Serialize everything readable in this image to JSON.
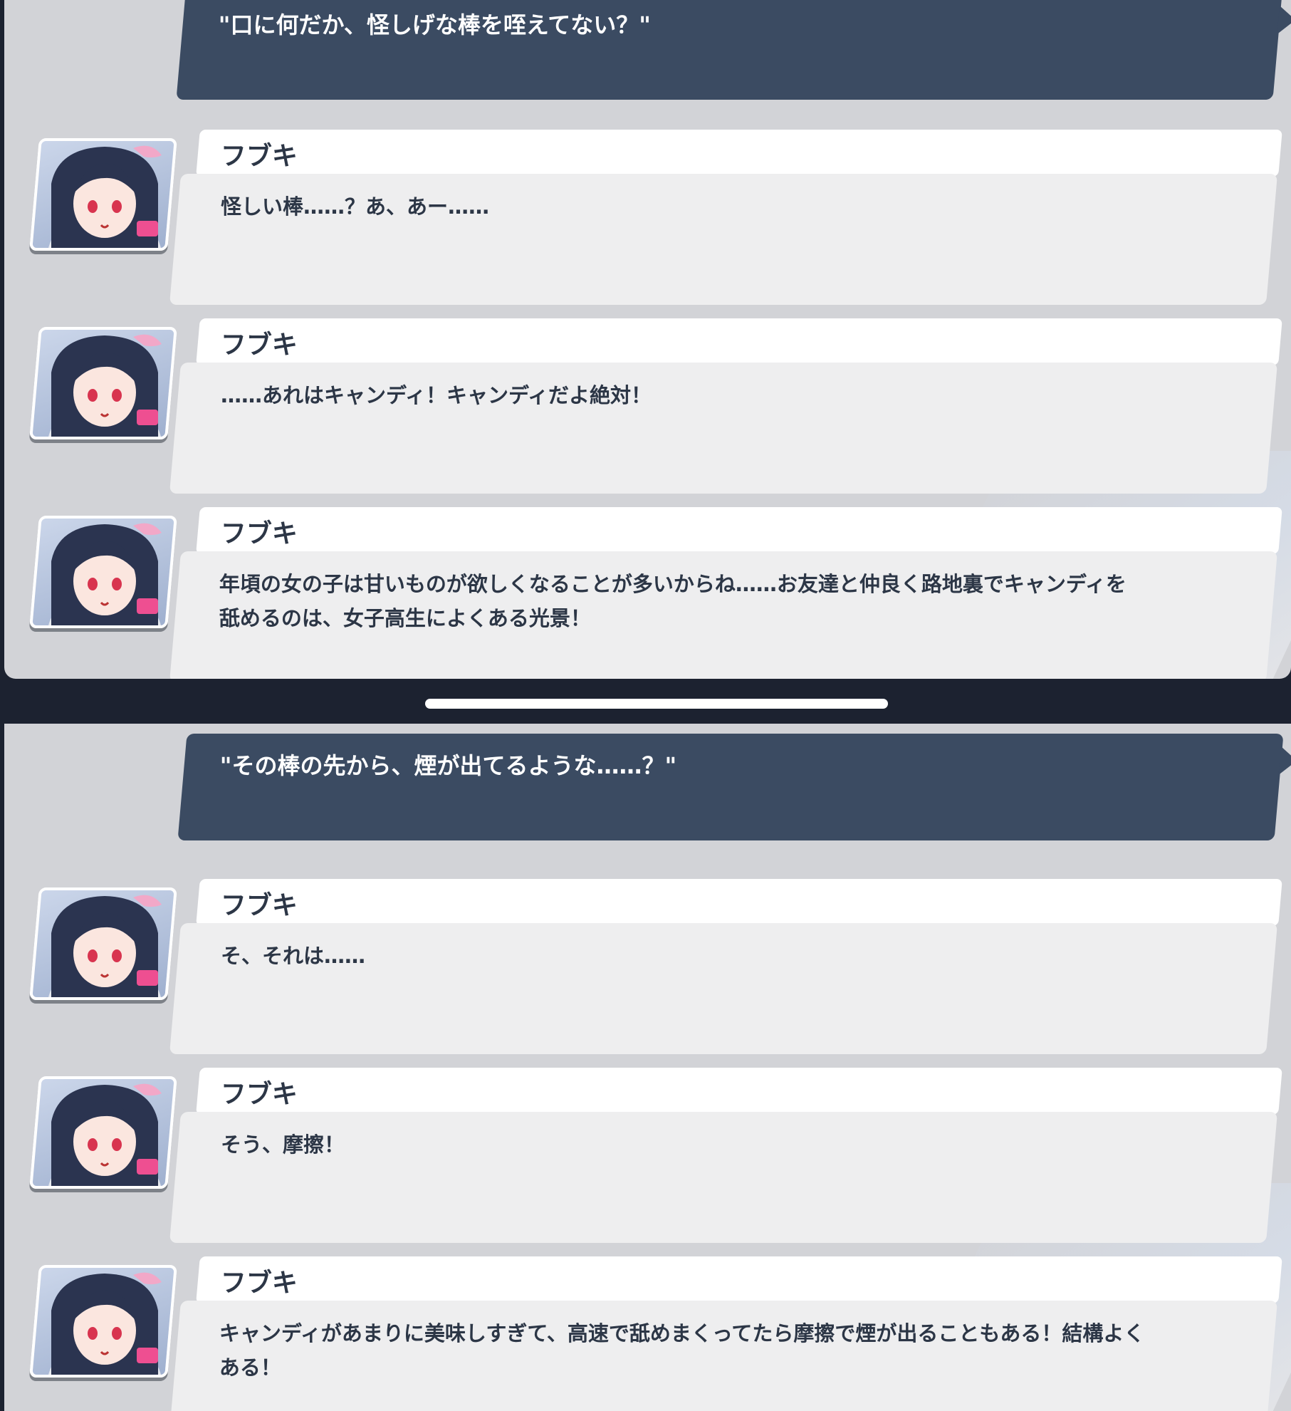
{
  "panel_1": {
    "choice": "\"口に何だか、怪しげな棒を咥えてない？\"",
    "messages": [
      {
        "name": "フブキ",
        "text": "怪しい棒……？あ、あー……"
      },
      {
        "name": "フブキ",
        "text": "……あれはキャンディ！キャンディだよ絶対！"
      },
      {
        "name": "フブキ",
        "text": "年頃の女の子は甘いものが欲しくなることが多いからね……お友達と仲良く路地裏でキャンディを舐めるのは、女子高生によくある光景！"
      }
    ]
  },
  "panel_2": {
    "choice": "\"その棒の先から、煙が出てるような……？\"",
    "messages": [
      {
        "name": "フブキ",
        "text": "そ、それは……"
      },
      {
        "name": "フブキ",
        "text": "そう、摩擦！"
      },
      {
        "name": "フブキ",
        "text": "キャンディがあまりに美味しすぎて、高速で舐めまくってたら摩擦で煙が出ることもある！結構よくある！"
      }
    ]
  },
  "colors": {
    "choice_bg": "#3b4b62",
    "name_bg": "#ffffff",
    "message_bg": "#eeeeef",
    "panel_bg": "#d2d3d7",
    "text": "#2c3646"
  },
  "icons": {
    "avatar": "character-portrait-fubuki"
  }
}
